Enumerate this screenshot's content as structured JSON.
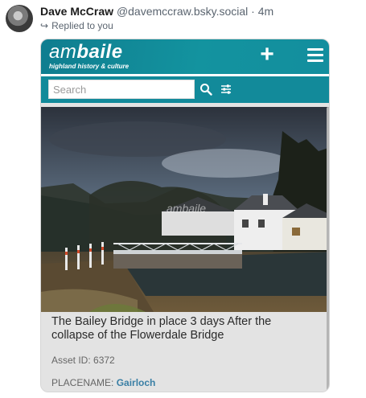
{
  "post": {
    "author_name": "Dave McCraw",
    "author_handle": "@davemccraw.bsky.social",
    "separator": "·",
    "age": "4m",
    "reply_note": "Replied to you"
  },
  "embed": {
    "logo_main_light": "am",
    "logo_main_bold": "baile",
    "logo_sub": "highland history & culture",
    "search_placeholder": "Search",
    "watermark": "ambaile",
    "caption": "The Bailey Bridge in place 3 days After the collapse of the Flowerdale Bridge",
    "asset_label": "Asset ID:",
    "asset_id": "6372",
    "place_label": "PLACENAME:",
    "place_value": "Gairloch",
    "accent_color": "#128a9a",
    "link_color": "#3a7fa5"
  },
  "icons": {
    "plus": "plus-icon",
    "menu": "menu-icon",
    "search": "search-icon",
    "filter": "filter-icon",
    "reply": "reply-arrow-icon"
  }
}
